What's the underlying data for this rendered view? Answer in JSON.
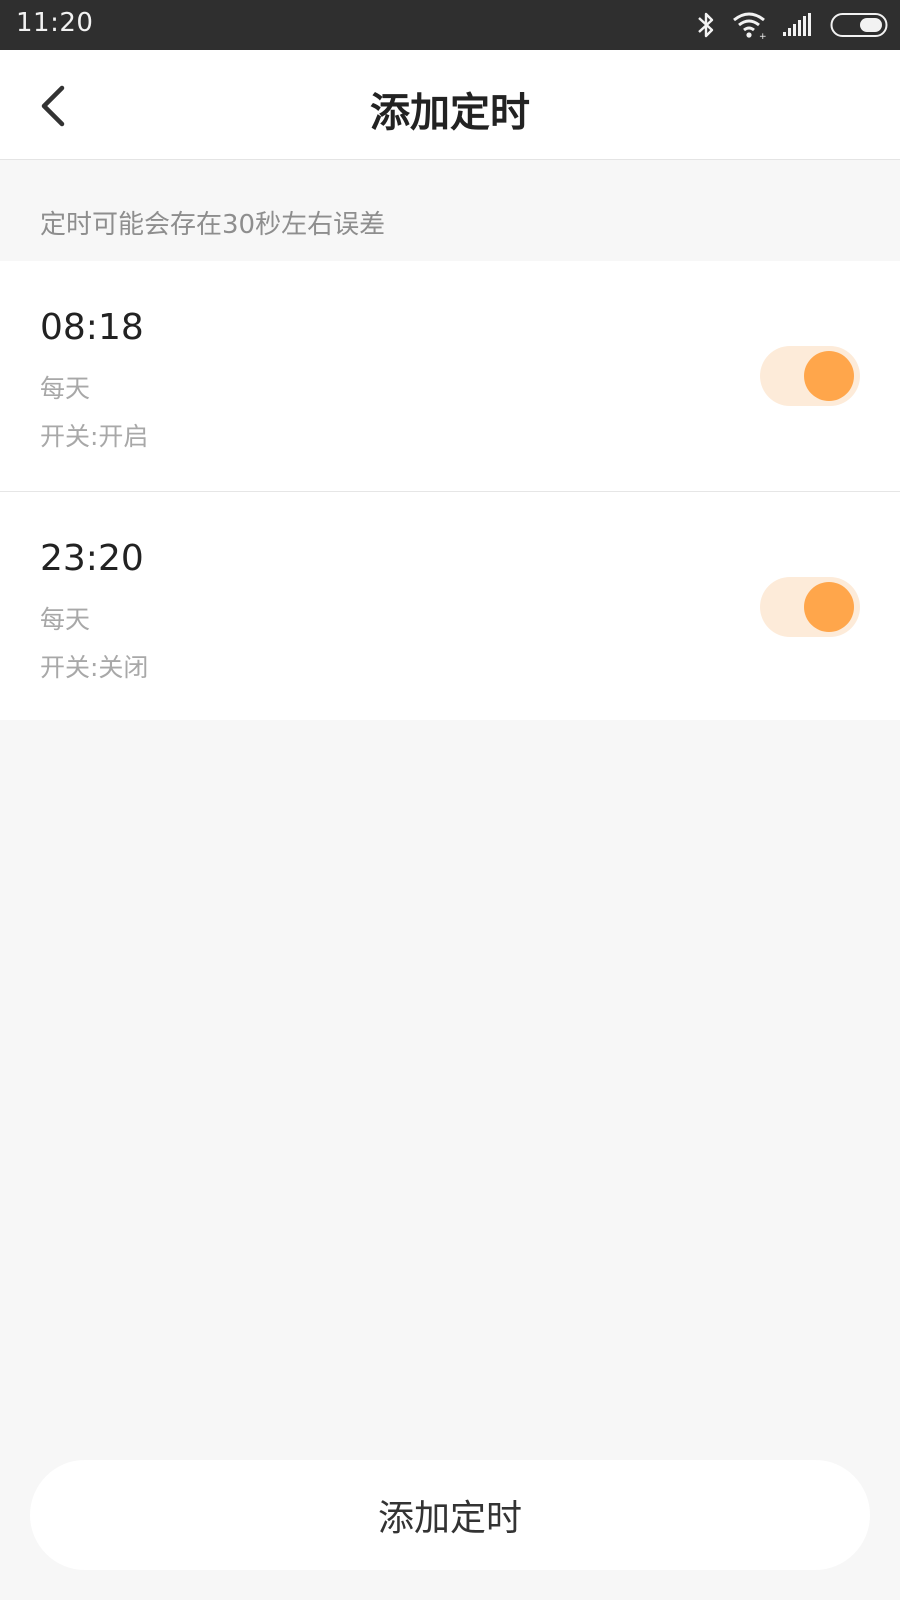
{
  "status_bar": {
    "time": "11:20",
    "icons": [
      "bluetooth-icon",
      "wifi-icon",
      "signal-icon",
      "battery-icon"
    ]
  },
  "header": {
    "title": "添加定时",
    "back_icon": "back-arrow-icon"
  },
  "hint": "定时可能会存在30秒左右误差",
  "timers": [
    {
      "time": "08:18",
      "repeat": "每天",
      "action": "开关:开启",
      "enabled": true
    },
    {
      "time": "23:20",
      "repeat": "每天",
      "action": "开关:关闭",
      "enabled": true
    }
  ],
  "add_button": {
    "label": "添加定时"
  },
  "colors": {
    "accent": "#ffa64b",
    "accent_track": "#fdebd9",
    "status_bar_bg": "#2f2f2f",
    "page_bg": "#f7f7f7"
  }
}
